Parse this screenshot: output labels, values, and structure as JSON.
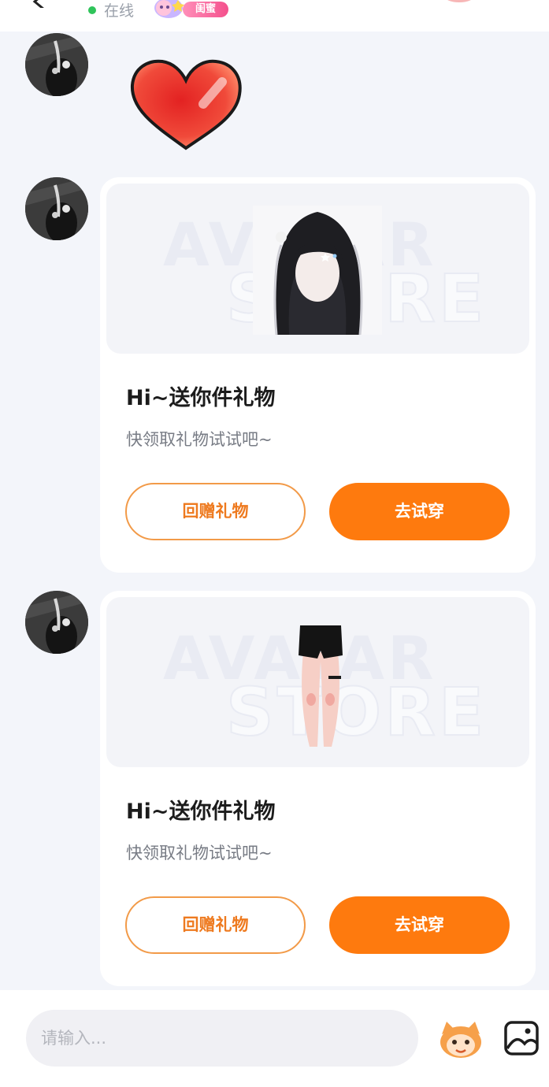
{
  "header": {
    "status_text": "在线",
    "relation_badge": "闺蜜"
  },
  "messages": {
    "gift_cards": [
      {
        "title": "Hi~送你件礼物",
        "subtitle": "快领取礼物试试吧~",
        "return_button": "回赠礼物",
        "try_button": "去试穿",
        "banner_watermark_1": "AVATAR",
        "banner_watermark_2": "STORE",
        "item_icon": "hair-icon"
      },
      {
        "title": "Hi~送你件礼物",
        "subtitle": "快领取礼物试试吧~",
        "return_button": "回赠礼物",
        "try_button": "去试穿",
        "banner_watermark_1": "AVATAR",
        "banner_watermark_2": "STORE",
        "item_icon": "shorts-icon"
      }
    ],
    "sticker_icon": "heart-icon"
  },
  "composer": {
    "placeholder": "请输入..."
  },
  "colors": {
    "accent": "#fe7a0e",
    "background": "#f3f5fa",
    "online": "#2fc45a"
  }
}
